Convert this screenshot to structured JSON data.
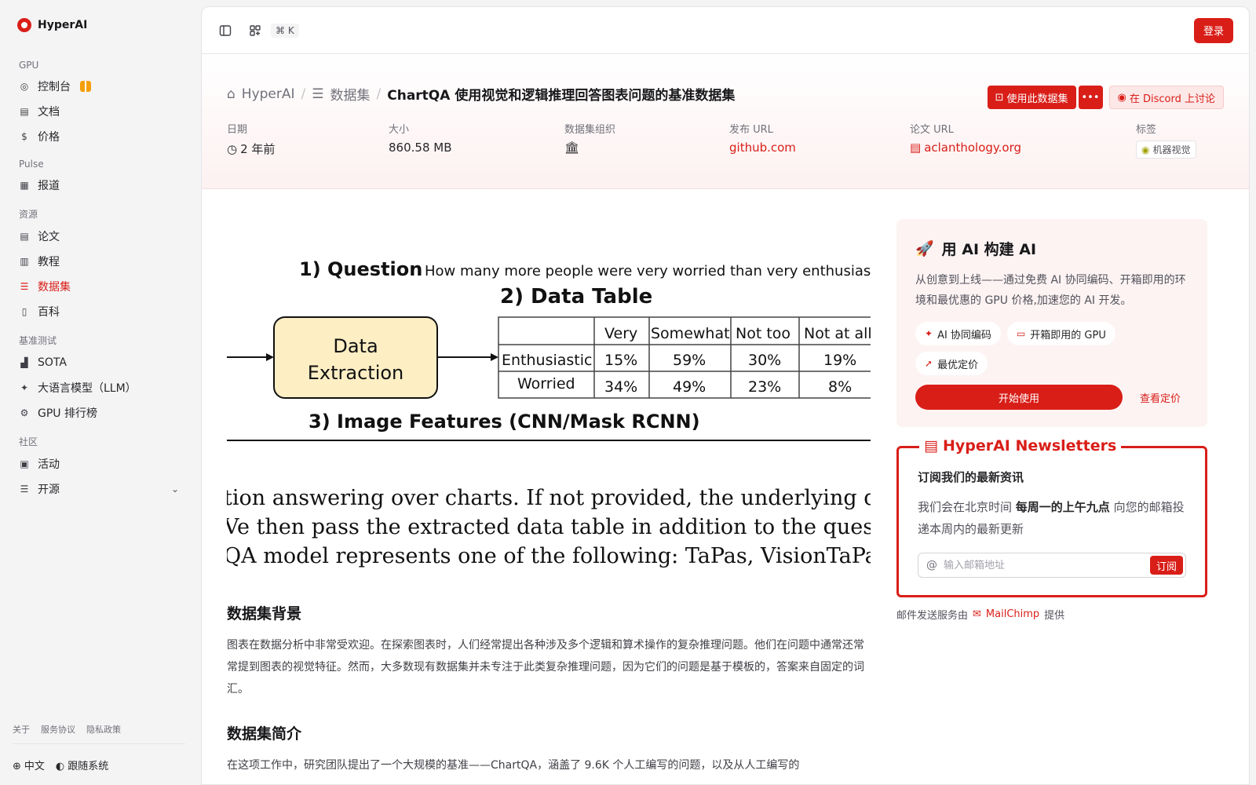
{
  "brand": {
    "name": "HyperAI"
  },
  "sidebar": {
    "sections": [
      {
        "title": "GPU",
        "items": [
          {
            "label": "控制台",
            "icon": "dashboard-icon",
            "gift": true
          },
          {
            "label": "文档",
            "icon": "doc-icon"
          },
          {
            "label": "价格",
            "icon": "dollar-icon"
          }
        ]
      },
      {
        "title": "Pulse",
        "items": [
          {
            "label": "报道",
            "icon": "news-icon"
          }
        ]
      },
      {
        "title": "资源",
        "items": [
          {
            "label": "论文",
            "icon": "paper-icon"
          },
          {
            "label": "教程",
            "icon": "book-icon"
          },
          {
            "label": "数据集",
            "icon": "database-icon",
            "active": true
          },
          {
            "label": "百科",
            "icon": "wiki-icon"
          }
        ]
      },
      {
        "title": "基准测试",
        "items": [
          {
            "label": "SOTA",
            "icon": "bar-chart-icon"
          },
          {
            "label": "大语言模型（LLM）",
            "icon": "sparkle-icon"
          },
          {
            "label": "GPU 排行榜",
            "icon": "chip-icon"
          }
        ]
      },
      {
        "title": "社区",
        "items": [
          {
            "label": "活动",
            "icon": "calendar-icon"
          },
          {
            "label": "开源",
            "icon": "list-icon",
            "chevron": true
          }
        ]
      }
    ],
    "footer_links": [
      "关于",
      "服务协议",
      "隐私政策"
    ],
    "language": "中文",
    "theme": "跟随系统"
  },
  "topbar": {
    "shortcut": "⌘ K",
    "login": "登录"
  },
  "header": {
    "crumbs": {
      "home": "HyperAI",
      "datasets": "数据集",
      "current": "ChartQA 使用视觉和逻辑推理回答图表问题的基准数据集"
    },
    "actions": {
      "use": "使用此数据集",
      "discord": "在 Discord 上讨论"
    },
    "meta": {
      "date": {
        "label": "日期",
        "value": "2 年前"
      },
      "size": {
        "label": "大小",
        "value": "860.58 MB"
      },
      "org": {
        "label": "数据集组织"
      },
      "release": {
        "label": "发布 URL",
        "value": "github.com"
      },
      "paper": {
        "label": "论文 URL",
        "value": "aclanthology.org"
      },
      "tags": {
        "label": "标签",
        "value": "机器视觉"
      }
    }
  },
  "figure": {
    "q_title": "1) Question",
    "q_text": "How many more people were very worried than very enthusiastic?",
    "dt_title": "2) Data Table",
    "box_line1": "Data",
    "box_line2": "Extraction",
    "table": {
      "headers": [
        "Very",
        "Somewhat",
        "Not too",
        "Not at all"
      ],
      "rows": [
        {
          "label": "Enthusiastic",
          "cells": [
            "15%",
            "59%",
            "30%",
            "19%"
          ]
        },
        {
          "label": "Worried",
          "cells": [
            "34%",
            "49%",
            "23%",
            "8%"
          ]
        }
      ]
    },
    "img_title": "3) Image Features (CNN/Mask RCNN)",
    "lines": [
      "tion answering over charts. If not provided, the underlying data",
      "Ve then pass the extracted data table in addition to the question",
      "QA model represents one of the following: TaPas, VisionTaPas"
    ]
  },
  "content": {
    "bg_title": "数据集背景",
    "bg_text": "图表在数据分析中非常受欢迎。在探索图表时，人们经常提出各种涉及多个逻辑和算术操作的复杂推理问题。他们在问题中通常还常常提到图表的视觉特征。然而，大多数现有数据集并未专注于此类复杂推理问题，因为它们的问题是基于模板的，答案来自固定的词汇。",
    "intro_title": "数据集简介",
    "intro_text": "在这项工作中，研究团队提出了一个大规模的基准——ChartQA，涵盖了 9.6K 个人工编写的问题，以及从人工编写的"
  },
  "promo": {
    "title": "用 AI 构建 AI",
    "text": "从创意到上线——通过免费 AI 协同编码、开箱即用的环境和最优惠的 GPU 价格,加速您的 AI 开发。",
    "chips": [
      "AI 协同编码",
      "开箱即用的 GPU",
      "最优定价"
    ],
    "start": "开始使用",
    "pricing": "查看定价"
  },
  "newsletter": {
    "title": "HyperAI Newsletters",
    "subtitle": "订阅我们的最新资讯",
    "text_pre": "我们会在北京时间 ",
    "text_bold": "每周一的上午九点",
    "text_post": " 向您的邮箱投递本周内的最新更新",
    "placeholder": "输入邮箱地址",
    "subscribe": "订阅",
    "powered_pre": "邮件发送服务由",
    "powered_name": "MailChimp",
    "powered_post": "提供"
  },
  "colors": {
    "accent": "#d91e18"
  }
}
